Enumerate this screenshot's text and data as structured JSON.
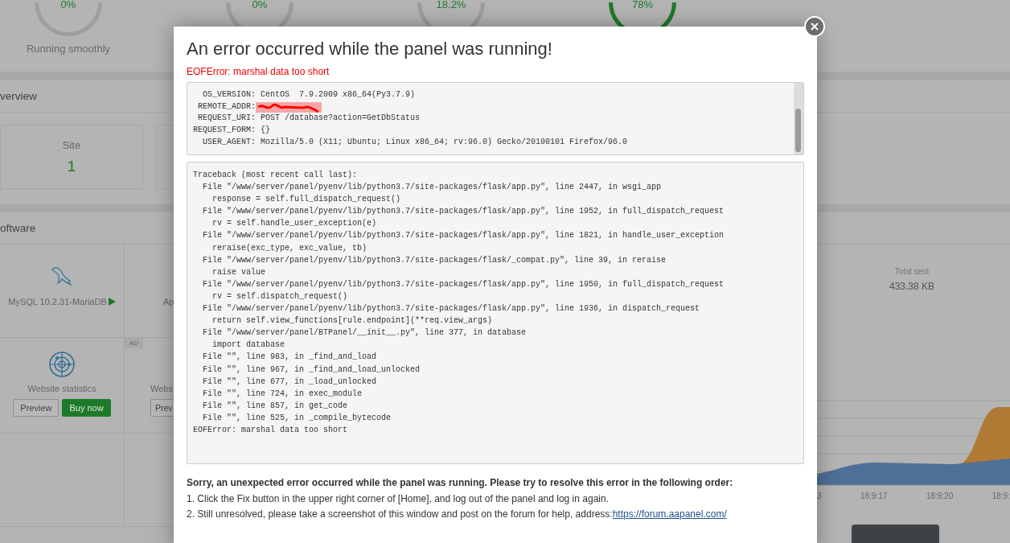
{
  "dashboard": {
    "gauges": [
      {
        "value": "0%",
        "color": "#9e9e9e",
        "label": "Running smoothly"
      },
      {
        "value": "0%",
        "color": "#9e9e9e"
      },
      {
        "value": "18.2%",
        "color": "#9e9e9e"
      },
      {
        "value": "78%",
        "color": "#1e7a2a"
      }
    ],
    "overview": {
      "title": "verview",
      "cards": [
        {
          "label": "Site",
          "value": "1"
        }
      ]
    },
    "software": {
      "title": "oftware",
      "apps": [
        {
          "kind": "installed",
          "name": "MySQL 10.2.31-MariaDB",
          "running": true
        },
        {
          "kind": "installed",
          "name": "Ap"
        },
        {
          "kind": "ad",
          "name": "Website statistics",
          "buttons": [
            "Preview",
            "Buy now"
          ]
        },
        {
          "kind": "ad",
          "name": "Webs",
          "buttons": [
            "Prev"
          ]
        }
      ],
      "ad_badge": "AD"
    },
    "traffic": {
      "stats": [
        {
          "label": "Total sent",
          "value": "433.38 KB"
        }
      ],
      "chart_ticks": [
        "3",
        "18:9:17",
        "18:9:20",
        "18:9:"
      ]
    }
  },
  "dialog": {
    "title": "An error occurred while the panel was running!",
    "error": "EOFError: marshal data too short",
    "info_lines": [
      {
        "text": "  OS_VERSION: CentOS  7.9.2009 x86_64(Py3.7.9)",
        "redacted": false
      },
      {
        "text": " REMOTE_ADDR:",
        "redacted": true
      },
      {
        "text": " REQUEST_URI: POST /database?action=GetDbStatus",
        "redacted": false
      },
      {
        "text": "REQUEST_FORM: {}",
        "redacted": false
      },
      {
        "text": "  USER_AGENT: Mozilla/5.0 (X11; Ubuntu; Linux x86_64; rv:96.0) Gecko/20100101 Firefox/96.0",
        "redacted": false
      }
    ],
    "traceback": [
      "Traceback (most recent call last):",
      "  File \"/www/server/panel/pyenv/lib/python3.7/site-packages/flask/app.py\", line 2447, in wsgi_app",
      "    response = self.full_dispatch_request()",
      "  File \"/www/server/panel/pyenv/lib/python3.7/site-packages/flask/app.py\", line 1952, in full_dispatch_request",
      "    rv = self.handle_user_exception(e)",
      "  File \"/www/server/panel/pyenv/lib/python3.7/site-packages/flask/app.py\", line 1821, in handle_user_exception",
      "    reraise(exc_type, exc_value, tb)",
      "  File \"/www/server/panel/pyenv/lib/python3.7/site-packages/flask/_compat.py\", line 39, in reraise",
      "    raise value",
      "  File \"/www/server/panel/pyenv/lib/python3.7/site-packages/flask/app.py\", line 1950, in full_dispatch_request",
      "    rv = self.dispatch_request()",
      "  File \"/www/server/panel/pyenv/lib/python3.7/site-packages/flask/app.py\", line 1936, in dispatch_request",
      "    return self.view_functions[rule.endpoint](**req.view_args)",
      "  File \"/www/server/panel/BTPanel/__init__.py\", line 377, in database",
      "    import database",
      "  File \"\", line 983, in _find_and_load",
      "  File \"\", line 967, in _find_and_load_unlocked",
      "  File \"\", line 677, in _load_unlocked",
      "  File \"\", line 724, in exec_module",
      "  File \"\", line 857, in get_code",
      "  File \"\", line 525, in _compile_bytecode",
      "EOFError: marshal data too short"
    ],
    "help": {
      "heading": "Sorry, an unexpected error occurred while the panel was running. Please try to resolve this error in the following order:",
      "steps": [
        {
          "text": "1. Click the Fix button in the upper right corner of [Home], and log out of the panel and log in again."
        },
        {
          "text": "2. Still unresolved, please take a screenshot of this window and post on the forum for help, address:",
          "link": "https://forum.aapanel.com/"
        }
      ]
    }
  }
}
